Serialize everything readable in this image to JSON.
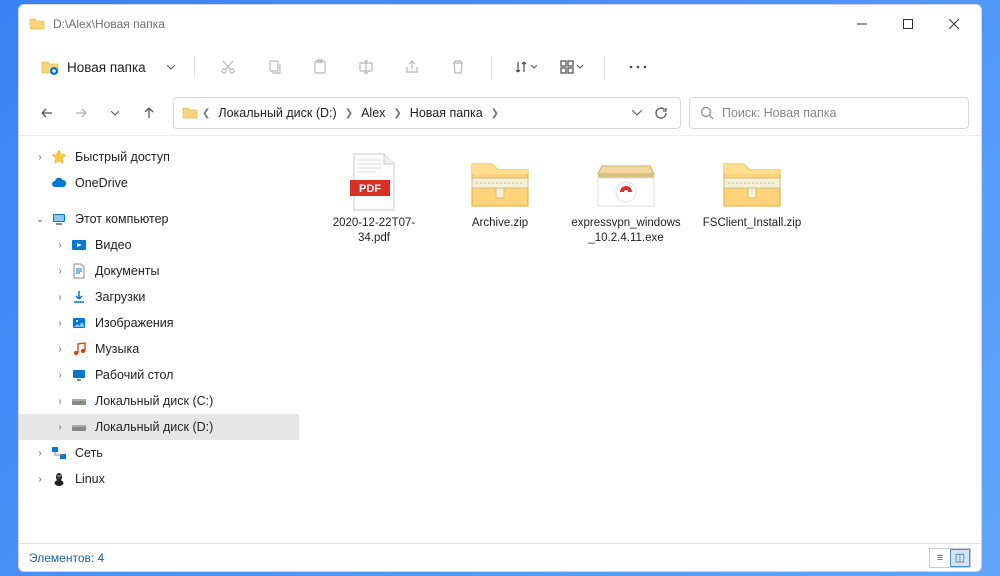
{
  "title": "D:\\Alex\\Новая папка",
  "toolbar": {
    "new_label": "Новая папка"
  },
  "breadcrumb": [
    "Локальный диск (D:)",
    "Alex",
    "Новая папка"
  ],
  "search": {
    "placeholder": "Поиск: Новая папка"
  },
  "sidebar": {
    "items": [
      {
        "label": "Быстрый доступ",
        "icon": "star",
        "depth": 0,
        "exp": ">"
      },
      {
        "label": "OneDrive",
        "icon": "cloud",
        "depth": 0,
        "exp": ""
      },
      {
        "label": "",
        "spacer": true
      },
      {
        "label": "Этот компьютер",
        "icon": "pc",
        "depth": 0,
        "exp": "v"
      },
      {
        "label": "Видео",
        "icon": "video",
        "depth": 1,
        "exp": ">"
      },
      {
        "label": "Документы",
        "icon": "doc",
        "depth": 1,
        "exp": ">"
      },
      {
        "label": "Загрузки",
        "icon": "dl",
        "depth": 1,
        "exp": ">"
      },
      {
        "label": "Изображения",
        "icon": "img",
        "depth": 1,
        "exp": ">"
      },
      {
        "label": "Музыка",
        "icon": "music",
        "depth": 1,
        "exp": ">"
      },
      {
        "label": "Рабочий стол",
        "icon": "desk",
        "depth": 1,
        "exp": ">"
      },
      {
        "label": "Локальный диск (C:)",
        "icon": "drive",
        "depth": 1,
        "exp": ">"
      },
      {
        "label": "Локальный диск (D:)",
        "icon": "drive",
        "depth": 1,
        "exp": ">",
        "selected": true
      },
      {
        "label": "Сеть",
        "icon": "net",
        "depth": 0,
        "exp": ">"
      },
      {
        "label": "Linux",
        "icon": "linux",
        "depth": 0,
        "exp": ">"
      }
    ]
  },
  "files": [
    {
      "name": "2020-12-22T07-34.pdf",
      "type": "pdf"
    },
    {
      "name": "Archive.zip",
      "type": "zip"
    },
    {
      "name": "expressvpn_windows_10.2.4.11.exe",
      "type": "exe"
    },
    {
      "name": "FSClient_Install.zip",
      "type": "zip"
    }
  ],
  "status": {
    "count_label": "Элементов: 4"
  }
}
